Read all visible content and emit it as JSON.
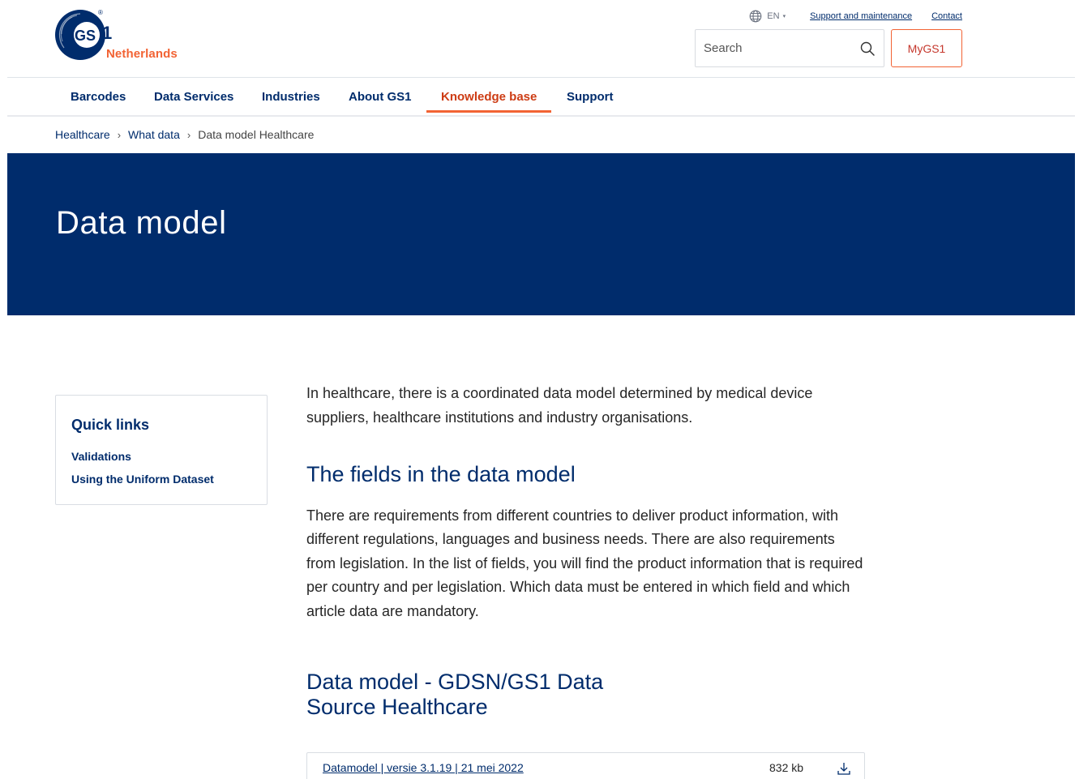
{
  "header": {
    "logo": {
      "mark_text": "GS1",
      "subtitle": "Netherlands"
    },
    "language": {
      "label": "EN",
      "icon": "globe-icon",
      "caret": "▾"
    },
    "utility_links": [
      "Support and maintenance",
      "Contact"
    ],
    "search": {
      "placeholder": "Search",
      "icon": "search-icon"
    },
    "mygs1_label": "MyGS1"
  },
  "nav": {
    "items": [
      {
        "label": "Barcodes",
        "active": false
      },
      {
        "label": "Data Services",
        "active": false
      },
      {
        "label": "Industries",
        "active": false
      },
      {
        "label": "About GS1",
        "active": false
      },
      {
        "label": "Knowledge base",
        "active": true
      },
      {
        "label": "Support",
        "active": false
      }
    ]
  },
  "breadcrumb": {
    "items": [
      "Healthcare",
      "What data"
    ],
    "separator": "›",
    "current": "Data model Healthcare"
  },
  "hero": {
    "title": "Data model"
  },
  "quicklinks": {
    "title": "Quick links",
    "links": [
      "Validations",
      "Using the Uniform Dataset"
    ]
  },
  "article": {
    "intro": "In healthcare, there is a coordinated data model determined by medical device suppliers, healthcare institutions and industry organisations.",
    "section1_title": "The fields in the data model",
    "section1_body": "There are requirements from different countries to deliver product information, with different regulations, languages and business needs. There are also requirements from legislation. In the list of fields, you will find the product information that is required per country and per legislation. Which data must be entered in which field and which article data are mandatory.",
    "section2_title": "Data model - GDSN/GS1 Data Source Healthcare"
  },
  "download": {
    "label": "Datamodel | versie 3.1.19 | 21 mei 2022",
    "size": "832 kb",
    "icon": "download-icon"
  },
  "colors": {
    "brand_blue": "#002c6c",
    "brand_orange": "#f26334",
    "active_red": "#cd3c14"
  }
}
